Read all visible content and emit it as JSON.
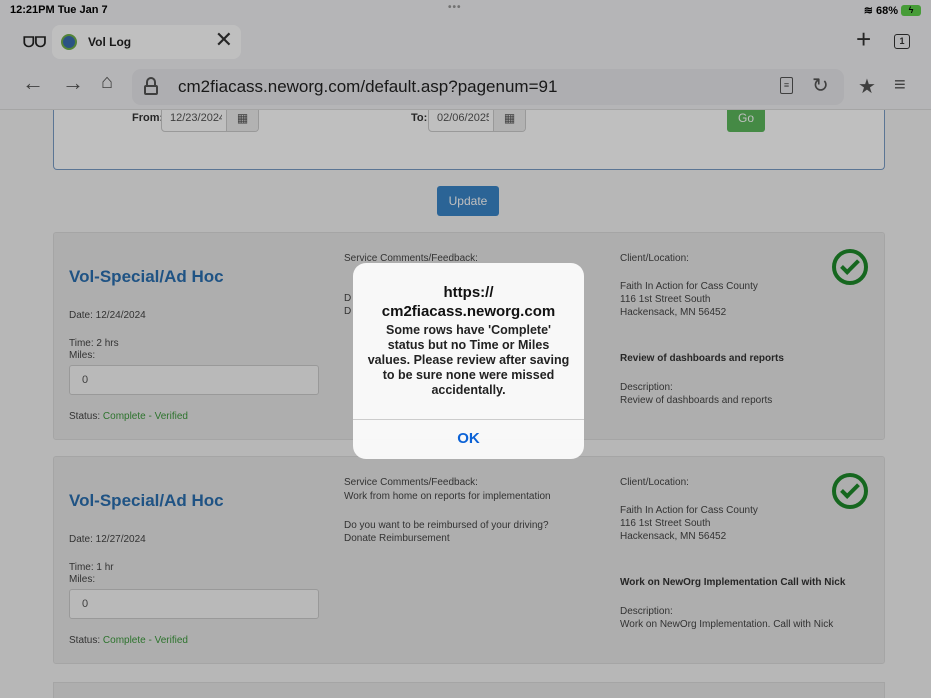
{
  "statusbar": {
    "time": "12:21PM  Tue Jan 7",
    "battery": "68%"
  },
  "tab": {
    "title": "Vol Log"
  },
  "browser": {
    "url": "cm2fiacass.neworg.com/default.asp?pagenum=91",
    "tab_count": "1"
  },
  "filter": {
    "from_label": "From:",
    "from_value": "12/23/2024",
    "to_label": "To:",
    "to_value": "02/06/2025",
    "go_label": "Go"
  },
  "update_label": "Update",
  "cards": [
    {
      "title": "Vol-Special/Ad Hoc",
      "date": "Date: 12/24/2024",
      "time": "Time: 2 hrs",
      "miles_label": "Miles:",
      "miles": "0",
      "status_label": "Status: ",
      "status_value": "Complete - Verified",
      "comments_label": "Service Comments/Feedback:",
      "comments": "",
      "reimburse_q": "D",
      "reimburse_a": "D",
      "client_label": "Client/Location:",
      "client_name": "Faith In Action for Cass County",
      "client_street": "116 1st Street South",
      "client_city": "Hackensack, MN 56452",
      "task": "Review of dashboards and reports",
      "desc_label": "Description:",
      "desc": "Review of dashboards and reports"
    },
    {
      "title": "Vol-Special/Ad Hoc",
      "date": "Date: 12/27/2024",
      "time": "Time: 1 hr",
      "miles_label": "Miles:",
      "miles": "0",
      "status_label": "Status: ",
      "status_value": "Complete - Verified",
      "comments_label": "Service Comments/Feedback:",
      "comments": "Work from home on reports for implementation",
      "reimburse_q": "Do you want to be reimbursed of your driving?",
      "reimburse_a": "Donate Reimbursement",
      "client_label": "Client/Location:",
      "client_name": "Faith In Action for Cass County",
      "client_street": "116 1st Street South",
      "client_city": "Hackensack, MN 56452",
      "task": "Work on NewOrg Implementation Call with Nick",
      "desc_label": "Description:",
      "desc": "Work on NewOrg Implementation. Call with Nick"
    }
  ],
  "dialog": {
    "title": "https://\ncm2fiacass.neworg.com",
    "message": "Some rows have 'Complete' status but no Time or Miles values.  Please review after saving to be sure none were missed accidentally.",
    "ok_label": "OK"
  }
}
